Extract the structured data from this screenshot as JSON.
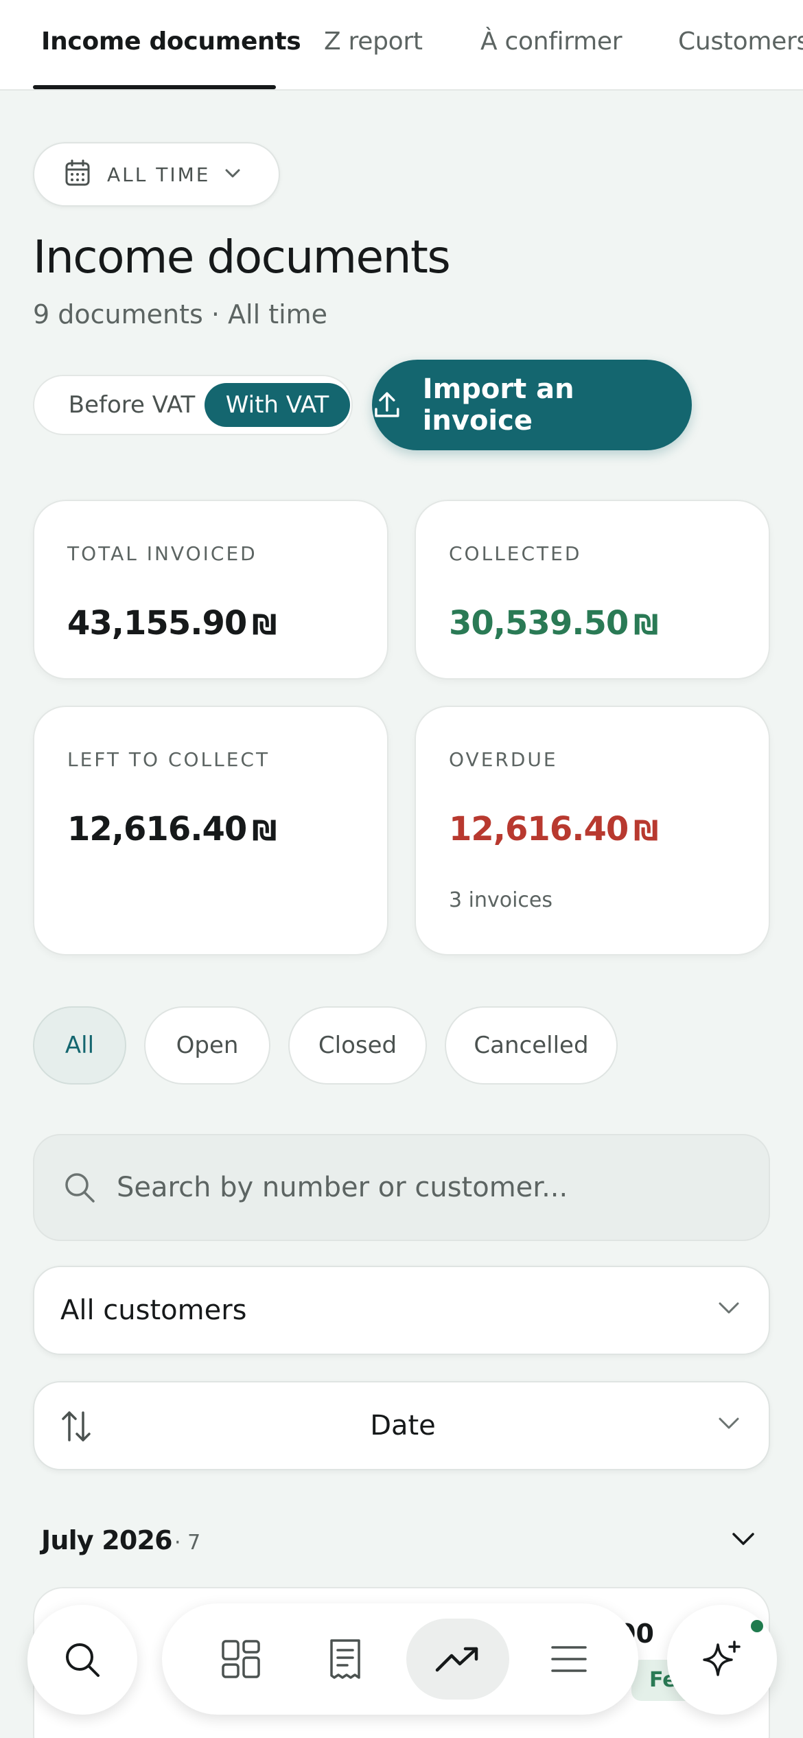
{
  "tabs": [
    {
      "label": "Income documents",
      "active": true
    },
    {
      "label": "Z report",
      "active": false
    },
    {
      "label": "À confirmer",
      "active": false
    },
    {
      "label": "Customers",
      "active": false
    }
  ],
  "date_filter": {
    "label": "ALL TIME",
    "icon": "calendar-icon"
  },
  "header": {
    "title": "Income documents",
    "subtitle": "9 documents · All time"
  },
  "vat_toggle": {
    "before_label": "Before VAT",
    "with_label": "With VAT",
    "selected": "With VAT"
  },
  "import_button": {
    "label": "Import an invoice",
    "icon": "upload-icon"
  },
  "stats": {
    "total_invoiced": {
      "label": "TOTAL INVOICED",
      "value": "43,155.90",
      "currency": "₪"
    },
    "collected": {
      "label": "COLLECTED",
      "value": "30,539.50",
      "currency": "₪"
    },
    "left_to_collect": {
      "label": "LEFT TO COLLECT",
      "value": "12,616.40",
      "currency": "₪"
    },
    "overdue": {
      "label": "OVERDUE",
      "value": "12,616.40",
      "currency": "₪",
      "note": "3 invoices"
    }
  },
  "status_filters": [
    {
      "label": "All",
      "active": true
    },
    {
      "label": "Open",
      "active": false
    },
    {
      "label": "Closed",
      "active": false
    },
    {
      "label": "Cancelled",
      "active": false
    }
  ],
  "search": {
    "placeholder": "Search by number or customer...",
    "value": ""
  },
  "customer_select": {
    "value": "All customers"
  },
  "sort_select": {
    "value": "Date",
    "icon": "sort-arrows-icon"
  },
  "group": {
    "month": "July 2026",
    "count": "· 7"
  },
  "partial_row": {
    "amount": "00",
    "badge": "Fe"
  },
  "bottom_nav": {
    "items": [
      "search-icon",
      "dashboard-icon",
      "receipt-icon",
      "trending-up-icon",
      "menu-icon",
      "sparkle-icon"
    ],
    "active": "trending-up-icon"
  },
  "colors": {
    "accent": "#14666f",
    "collected": "#2a7a55",
    "overdue": "#b8392f",
    "background": "#f1f5f3"
  }
}
